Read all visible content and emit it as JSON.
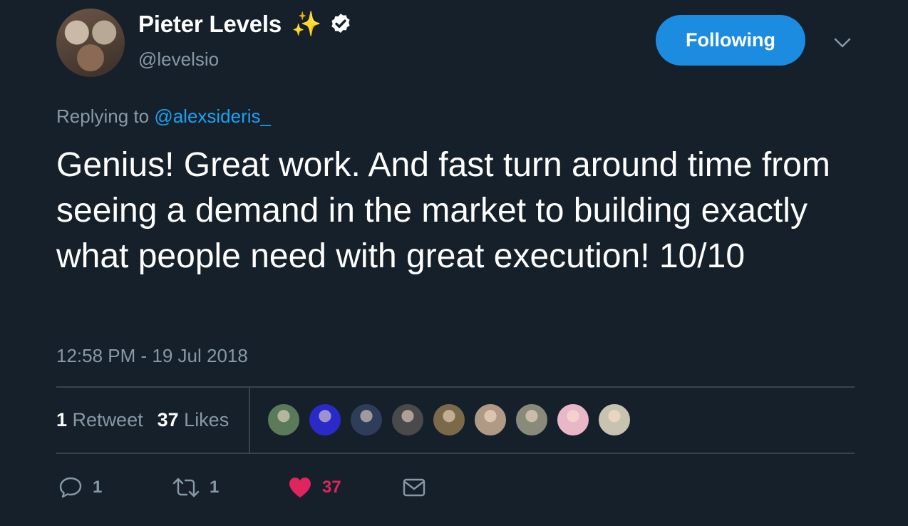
{
  "author": {
    "display_name": "Pieter Levels",
    "name_emoji": "✨",
    "handle": "@levelsio",
    "verified": true
  },
  "follow_button": {
    "label": "Following"
  },
  "reply": {
    "prefix": "Replying to ",
    "to_handle": "@alexsideris_"
  },
  "tweet": {
    "text": "Genius! Great work. And fast turn around time from seeing a demand in the market to building exactly what people need with great execution! 10/10",
    "timestamp": "12:58 PM - 19 Jul 2018"
  },
  "stats": {
    "retweet_count": "1",
    "retweet_label": "Retweet",
    "like_count": "37",
    "like_label": "Likes"
  },
  "likers": [
    {
      "name": "liker-1",
      "color": "#5a7a5a"
    },
    {
      "name": "liker-2",
      "color": "#2a2ac8"
    },
    {
      "name": "liker-3",
      "color": "#2e3e5a"
    },
    {
      "name": "liker-4",
      "color": "#4a4a4a"
    },
    {
      "name": "liker-5",
      "color": "#7a6a4a"
    },
    {
      "name": "liker-6",
      "color": "#b09a86"
    },
    {
      "name": "liker-7",
      "color": "#8a8a7a"
    },
    {
      "name": "liker-8",
      "color": "#e8b8c8"
    },
    {
      "name": "liker-9",
      "color": "#c8c2b0"
    }
  ],
  "actions": {
    "reply_count": "1",
    "retweet_count": "1",
    "like_count": "37"
  },
  "colors": {
    "background": "#15202b",
    "accent": "#1da1f2",
    "like": "#e0245e",
    "muted": "#8899a6"
  }
}
